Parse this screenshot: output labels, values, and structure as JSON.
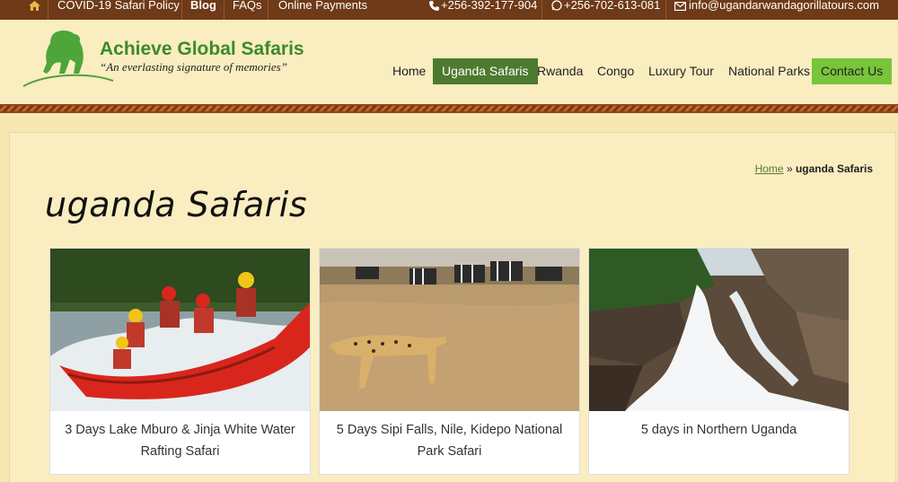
{
  "topbar": {
    "home_icon": "home-icon",
    "links": [
      "COVID-19 Safari Policy",
      "Blog",
      "FAQs",
      "Online Payments"
    ],
    "phone1": "+256-392-177-904",
    "phone2": "+256-702-613-081",
    "email": "info@ugandarwandagorillatours.com"
  },
  "logo": {
    "title": "Achieve Global Safaris",
    "tagline": "“An everlasting signature of memories”"
  },
  "nav": [
    "Home",
    "Uganda Safaris",
    "Rwanda",
    "Congo",
    "Luxury Tour",
    "National Parks",
    "Contact Us"
  ],
  "breadcrumb": {
    "home": "Home",
    "separator": "»",
    "current": "uganda Safaris"
  },
  "page": {
    "title": "uganda Safaris"
  },
  "cards": [
    {
      "caption": "3 Days Lake Mburo & Jinja White Water Rafting Safari"
    },
    {
      "caption": "5 Days Sipi Falls, Nile, Kidepo National Park Safari"
    },
    {
      "caption": "5 days in Northern Uganda"
    }
  ],
  "colors": {
    "topbar": "#6e3a17",
    "brand_green": "#3c8b2a",
    "nav_active": "#4e7a2f",
    "contact": "#78c43a",
    "background": "#f6e7b3"
  }
}
